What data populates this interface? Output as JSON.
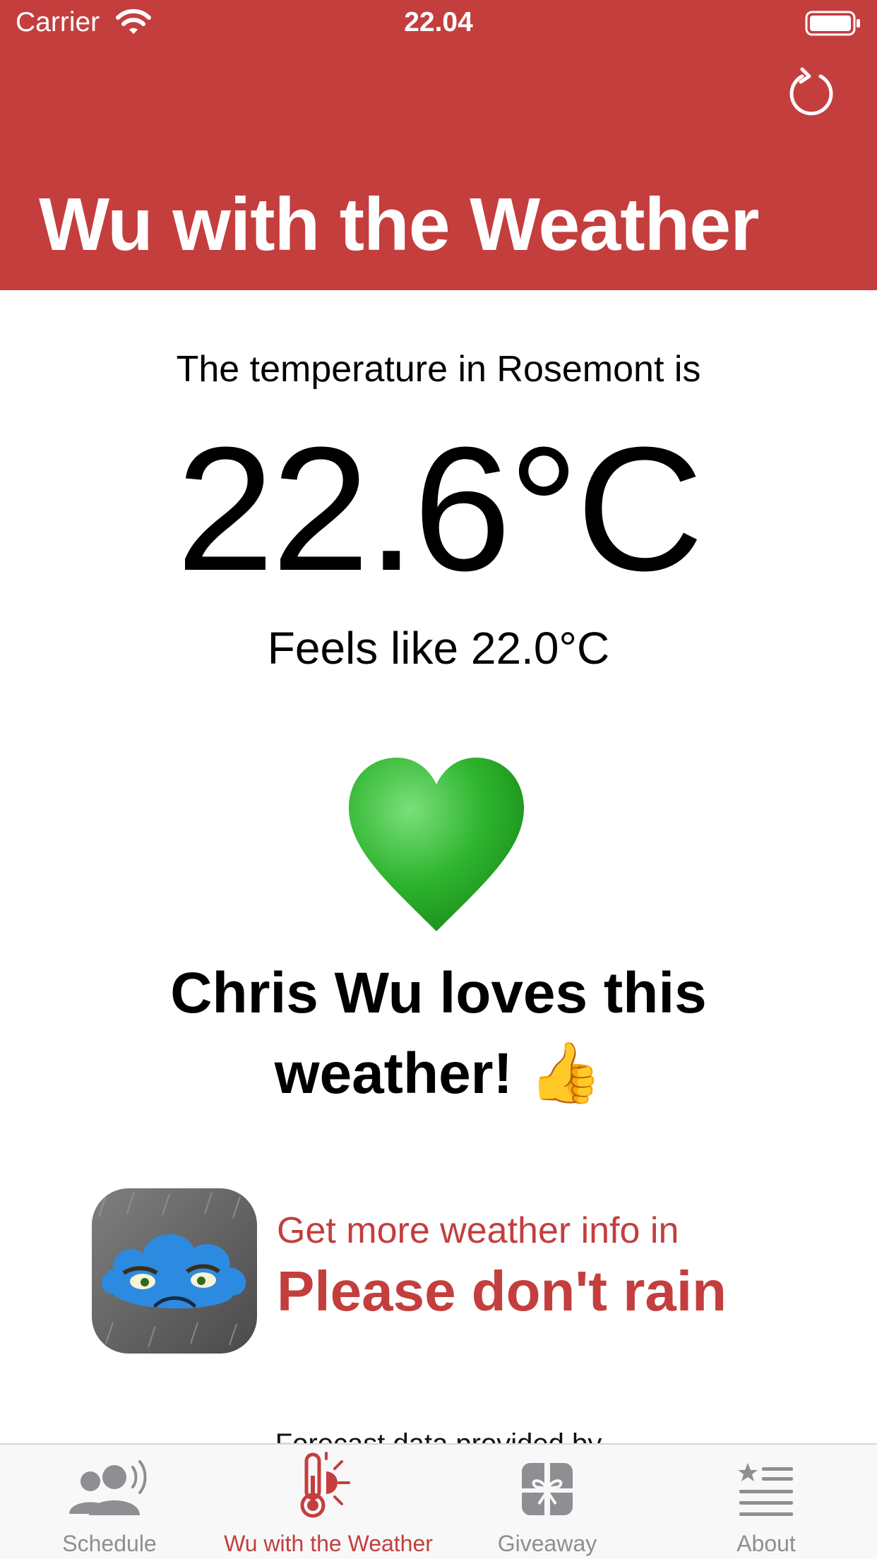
{
  "status_bar": {
    "carrier": "Carrier",
    "time": "22.04"
  },
  "header": {
    "title": "Wu with the Weather"
  },
  "weather": {
    "intro": "The temperature in Rosemont is",
    "temperature": "22.6°C",
    "feels_like": "Feels like 22.0°C",
    "verdict_line1": "Chris Wu loves this",
    "verdict_line2": "weather!",
    "verdict_emoji": "👍"
  },
  "promo": {
    "subtitle": "Get more weather info in",
    "app_name": "Please don't rain"
  },
  "footer_note": "Forecast data provided by",
  "tabs": [
    {
      "label": "Schedule",
      "icon": "people-speaking-icon",
      "active": false
    },
    {
      "label": "Wu with the Weather",
      "icon": "thermometer-sun-icon",
      "active": true
    },
    {
      "label": "Giveaway",
      "icon": "gift-icon",
      "active": false
    },
    {
      "label": "About",
      "icon": "list-star-icon",
      "active": false
    }
  ],
  "colors": {
    "accent": "#c43e3e",
    "heart": "#3cc23c",
    "tab_inactive": "#8e8e93"
  }
}
